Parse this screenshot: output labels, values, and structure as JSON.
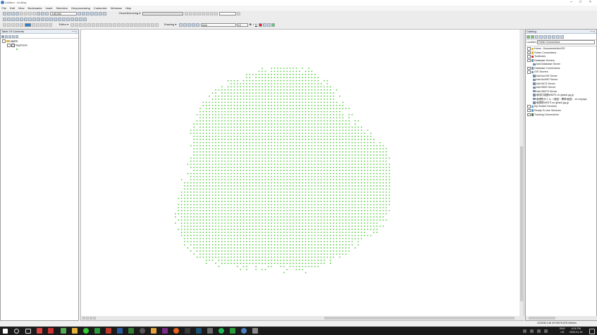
{
  "app": {
    "title": "Untitled - ArcMap",
    "colors": {
      "accent": "#4a7fc0",
      "point": "#55cc3f"
    }
  },
  "window_controls": {
    "minimize": "–",
    "maximize": "□",
    "close": "×"
  },
  "menus": [
    "File",
    "Edit",
    "View",
    "Bookmarks",
    "Insert",
    "Selection",
    "Geoprocessing",
    "Customize",
    "Windows",
    "Help"
  ],
  "toolbar": {
    "scale": "1:65,000",
    "georef_label": "Georeferencing ▾",
    "editor_label": "Editor ▾",
    "drawing_label": "Drawing ▾",
    "font": "Arial",
    "font_size": "10",
    "bold": "B",
    "italic": "I",
    "underline": "U"
  },
  "toc": {
    "title": "Table Of Contents",
    "pin": "ꟷ ×",
    "layers_label": "Layers",
    "layer_name": "MapPoints",
    "symbol_color": "#55cc3f"
  },
  "catalog": {
    "title": "Catalog",
    "pin": "ꟷ ×",
    "location_label": "Location:",
    "location_value": "Folder Connections",
    "items": [
      {
        "label": "Home - Documents\\ArcGIS",
        "icon": "folder-icon",
        "level": 0
      },
      {
        "label": "Folder Connections",
        "icon": "folder-icon",
        "level": 0
      },
      {
        "label": "Toolboxes",
        "icon": "toolbox-icon",
        "level": 0
      },
      {
        "label": "Database Servers",
        "icon": "db-icon",
        "level": 0
      },
      {
        "label": "Add Database Server",
        "icon": "db-icon",
        "level": 1
      },
      {
        "label": "Database Connections",
        "icon": "db-icon",
        "level": 0
      },
      {
        "label": "GIS Servers",
        "icon": "server-icon",
        "level": 0
      },
      {
        "label": "Add ArcGIS Server",
        "icon": "server-icon",
        "level": 1
      },
      {
        "label": "Add ArcIMS Server",
        "icon": "server-icon",
        "level": 1
      },
      {
        "label": "Add WCS Server",
        "icon": "server-icon",
        "level": 1
      },
      {
        "label": "Add WMS Server",
        "icon": "server-icon",
        "level": 1
      },
      {
        "label": "Add WMTS Server",
        "icon": "server-icon",
        "level": 1
      },
      {
        "label": "地球灯境图WMTS on gbank.gq.jp",
        "icon": "server-icon",
        "level": 1
      },
      {
        "label": "地理院タイル（地図・標準地図） on eviyaps",
        "icon": "server-icon",
        "level": 1
      },
      {
        "label": "地理院WMTS on gbank.gq.jp",
        "icon": "server-icon",
        "level": 1
      },
      {
        "label": "My Hosted Services",
        "icon": "cloud-icon",
        "level": 0
      },
      {
        "label": "Ready-To-Use Services",
        "icon": "cloud-icon",
        "level": 0
      },
      {
        "label": "Tracking Connections",
        "icon": "tracking-icon",
        "level": 0
      }
    ]
  },
  "status": {
    "coords": "412635.146  3076578.875 Meters"
  },
  "taskbar": {
    "lang": "ENG",
    "region": "US",
    "time": "4:04 PM",
    "date": "2020-01-16"
  }
}
